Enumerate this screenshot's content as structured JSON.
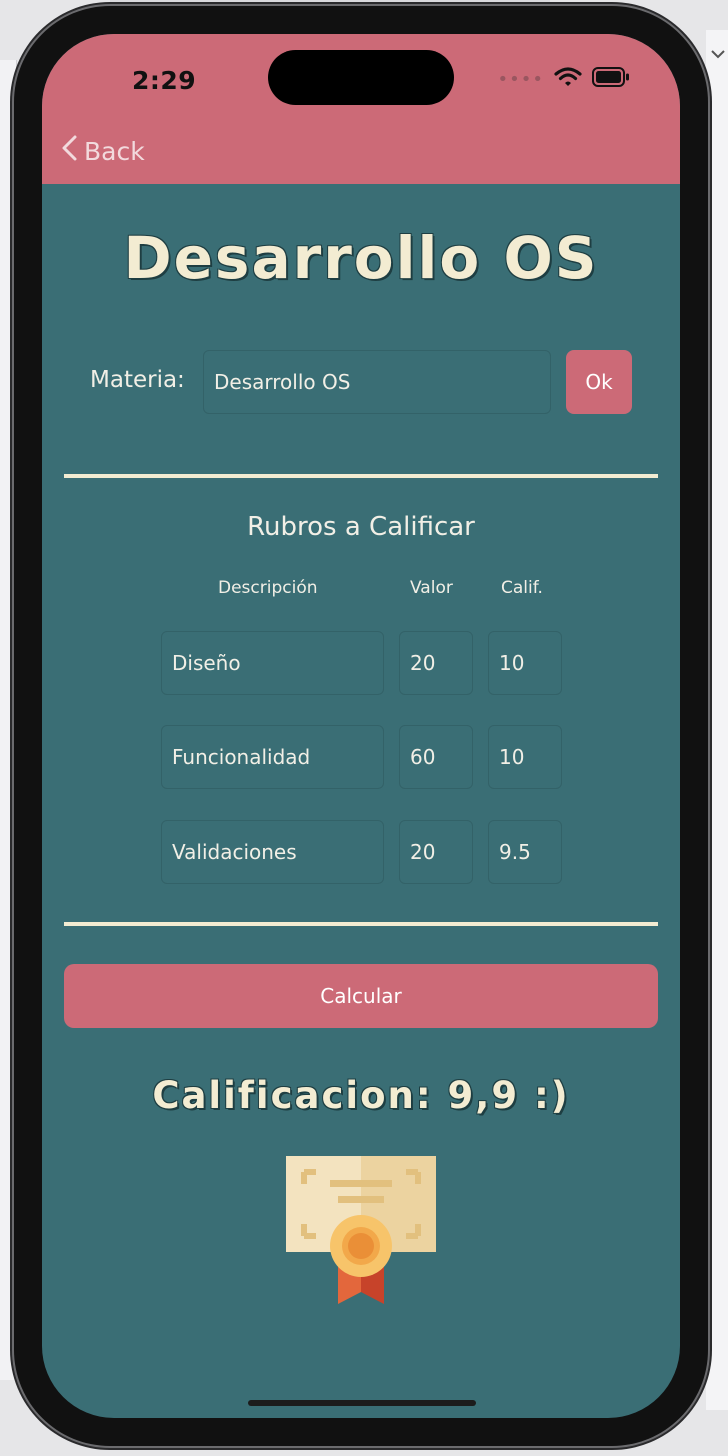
{
  "status_bar": {
    "time": "2:29"
  },
  "nav": {
    "back_label": "Back"
  },
  "page": {
    "title": "Desarrollo OS"
  },
  "materia": {
    "label": "Materia:",
    "value": "Desarrollo OS",
    "ok_label": "Ok"
  },
  "rubros": {
    "title": "Rubros a Calificar",
    "headers": {
      "descripcion": "Descripción",
      "valor": "Valor",
      "calif": "Calif."
    },
    "rows": [
      {
        "descripcion": "Diseño",
        "valor": "20",
        "calif": "10"
      },
      {
        "descripcion": "Funcionalidad",
        "valor": "60",
        "calif": "10"
      },
      {
        "descripcion": "Validaciones",
        "valor": "20",
        "calif": "9.5"
      }
    ]
  },
  "actions": {
    "calcular_label": "Calcular"
  },
  "result": {
    "text": "Calificacion: 9,9 :)"
  },
  "colors": {
    "header": "#cc6a77",
    "background": "#3a6e75",
    "accent_text": "#f3ecd2"
  },
  "icons": {
    "certificate": "certificate-icon"
  }
}
